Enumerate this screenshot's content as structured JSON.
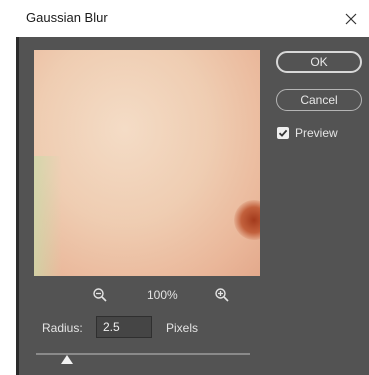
{
  "dialog": {
    "title": "Gaussian Blur",
    "close_icon": "close-icon"
  },
  "preview": {
    "zoom_out_icon": "zoom-out-icon",
    "zoom_in_icon": "zoom-in-icon",
    "zoom_level": "100%"
  },
  "controls": {
    "radius_label": "Radius:",
    "radius_value": "2.5",
    "units_label": "Pixels",
    "slider_thumb_icon": "triangle-up-icon"
  },
  "buttons": {
    "ok_label": "OK",
    "cancel_label": "Cancel"
  },
  "preview_toggle": {
    "label": "Preview",
    "checked": true,
    "check_icon": "checkmark-icon"
  },
  "colors": {
    "dialog_bg": "#535353",
    "titlebar_bg": "#ffffff",
    "text": "#e4e4e4",
    "input_bg": "#454545"
  }
}
